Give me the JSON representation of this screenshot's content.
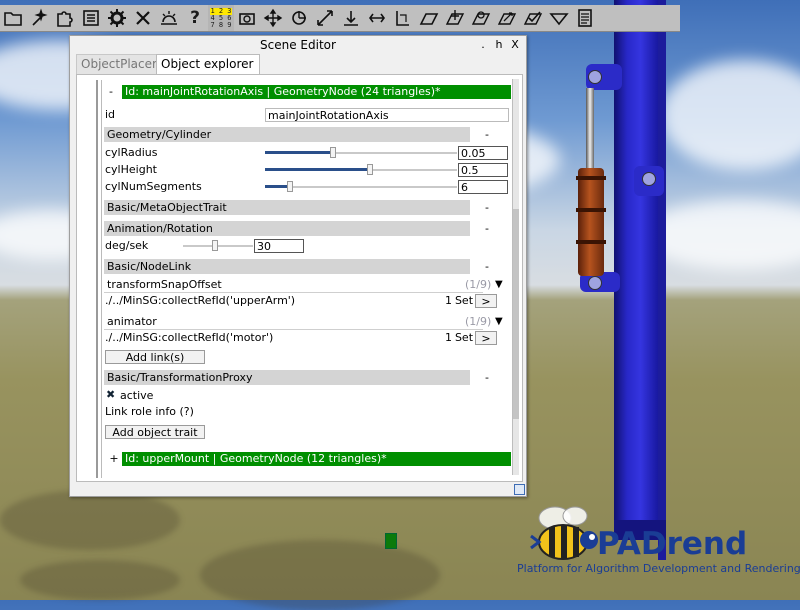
{
  "toolbar": {
    "icons": [
      "folder-icon",
      "wand-icon",
      "puzzle-icon",
      "list-icon",
      "gear-icon",
      "tools-icon",
      "sunset-icon",
      "help-icon",
      "numbers-icon",
      "camera-icon",
      "move-icon",
      "rotate-icon",
      "scale-icon",
      "snap-down-icon",
      "align-icon",
      "measure-icon",
      "plane-icon",
      "plane-move-icon",
      "plane-rotate-icon",
      "plane-scale-icon",
      "plane-check-icon",
      "plane-snap-icon",
      "properties-icon"
    ],
    "help_glyph": "?",
    "nums_row1": "1 2 3",
    "nums_row2": "4 5 6",
    "nums_row3": "7 8 9"
  },
  "window": {
    "title": "Scene Editor",
    "btn_dot": ".",
    "btn_h": "h",
    "btn_x": "X"
  },
  "tabs": [
    {
      "label": "ObjectPlacer",
      "active": false
    },
    {
      "label": "Object explorer",
      "active": true
    }
  ],
  "node1": {
    "toggle": "-",
    "header": "Id: mainJointRotationAxis | GeometryNode (24 triangles)*",
    "id_label": "id",
    "id_value": "mainJointRotationAxis"
  },
  "cylinder": {
    "header": "Geometry/Cylinder",
    "collapse": "-",
    "radius": {
      "label": "cylRadius",
      "value": "0.05",
      "slider_fraction": 0.35
    },
    "height": {
      "label": "cylHeight",
      "value": "0.5",
      "slider_fraction": 0.55
    },
    "segments": {
      "label": "cylNumSegments",
      "value": "6",
      "slider_fraction": 0.12
    }
  },
  "meta_trait": {
    "header": "Basic/MetaObjectTrait",
    "collapse": "-"
  },
  "rotation": {
    "header": "Animation/Rotation",
    "collapse": "-",
    "deg_label": "deg/sek",
    "deg_value": "30",
    "slider_fraction": 0.45
  },
  "node_link": {
    "header": "Basic/NodeLink",
    "collapse": "-",
    "links": [
      {
        "role": "transformSnapOffset",
        "count": "(1/9)",
        "expand": "▼",
        "path": "./../MinSG:collectRefId('upperArm')",
        "set_count": "1",
        "set_label": "Set",
        "go": ">"
      },
      {
        "role": "animator",
        "count": "(1/9)",
        "expand": "▼",
        "path": "./../MinSG:collectRefId('motor')",
        "set_count": "1",
        "set_label": "Set",
        "go": ">"
      }
    ],
    "add_links_label": "Add link(s)"
  },
  "transform_proxy": {
    "header": "Basic/TransformationProxy",
    "collapse": "-",
    "check_mark": "✖",
    "active_label": "active",
    "info_label": "Link role info (?)"
  },
  "add_trait_label": "Add object trait",
  "node2": {
    "toggle": "+",
    "header": "Id: upperMount | GeometryNode (12 triangles)*"
  },
  "logo": {
    "name": "PADrend",
    "tagline": "Platform for Algorithm Development and Rendering"
  },
  "colors": {
    "node_header": "#008f00",
    "tower_blue": "#2828c8",
    "logo_blue": "#1a3d95"
  }
}
